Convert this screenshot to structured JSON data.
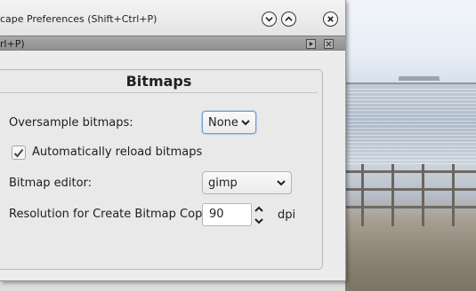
{
  "window": {
    "title": "cape Preferences (Shift+Ctrl+P)",
    "controls": {
      "minimize": "chevron-down-icon",
      "maximize": "chevron-up-icon",
      "close": "close-icon"
    }
  },
  "panel": {
    "title": "rl+P)",
    "controls": {
      "dock": "dock-arrow-icon",
      "close": "close-icon"
    }
  },
  "section": {
    "title": "Bitmaps"
  },
  "oversample": {
    "label": "Oversample bitmaps:",
    "value": "None"
  },
  "autoreload": {
    "label": "Automatically reload bitmaps",
    "checked": true
  },
  "editor": {
    "label": "Bitmap editor:",
    "value": "gimp"
  },
  "resolution": {
    "label": "Resolution for Create Bitmap Copy:",
    "value": "90",
    "unit": "dpi"
  },
  "colors": {
    "focus_border": "#6a9fd8",
    "panel_bar": "#9c9c9c",
    "window_bg": "#ececec"
  }
}
